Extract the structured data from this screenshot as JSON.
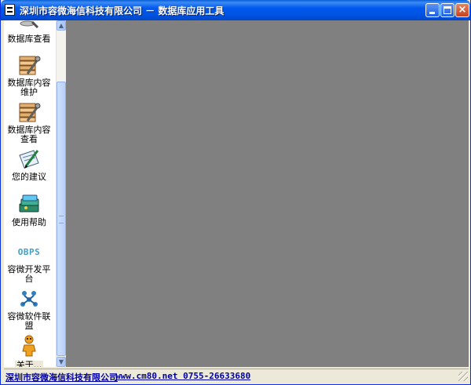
{
  "window": {
    "title": "深圳市容微海信科技有限公司 － 数据库应用工具",
    "controls": {
      "minimize_icon": "minimize-icon",
      "maximize_icon": "maximize-icon",
      "close_icon": "close-icon",
      "close_glyph": "×"
    },
    "title_color": "#0054e3"
  },
  "sidebar": {
    "items": [
      {
        "label": "数据库查看",
        "icon": "database-magnifier-icon"
      },
      {
        "label": "数据库内容\n维护",
        "icon": "database-wrench-icon"
      },
      {
        "label": "数据库内容\n查看",
        "icon": "database-wrench-view-icon"
      },
      {
        "label": "您的建议",
        "icon": "pen-paper-icon"
      },
      {
        "label": "使用帮助",
        "icon": "help-book-icon"
      },
      {
        "label": "容微开发平\n台",
        "icon": "obps-icon",
        "icon_text": "OBPS"
      },
      {
        "label": "容微软件联\n盟",
        "icon": "people-network-icon"
      },
      {
        "label": "关于...",
        "icon": "about-person-icon"
      }
    ],
    "scroll": {
      "up_glyph": "▲",
      "down_glyph": "▼",
      "position": 0.85
    }
  },
  "main": {
    "background": "#808080"
  },
  "statusbar": {
    "company": "深圳市容微海信科技有限公司",
    "contact": "www.cm80.net 0755-26633680",
    "link_color": "#0000a0"
  }
}
